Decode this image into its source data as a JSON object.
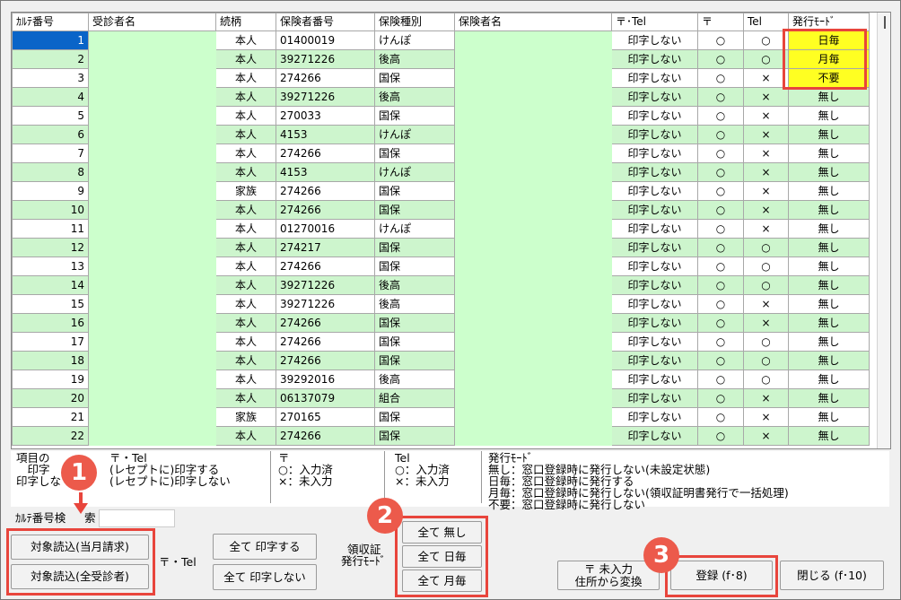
{
  "table": {
    "headers": [
      "ｶﾙﾃ番号",
      "受診者名",
      "続柄",
      "保険者番号",
      "保険種別",
      "保険者名",
      "〒･Tel",
      "〒",
      "Tel",
      "発行ﾓｰﾄﾞ"
    ],
    "rows": [
      [
        "1",
        "",
        "本人",
        "01400019",
        "けんぽ",
        "",
        "印字しない",
        "○",
        "○",
        "日毎"
      ],
      [
        "2",
        "",
        "本人",
        "39271226",
        "後高",
        "",
        "印字しない",
        "○",
        "○",
        "月毎"
      ],
      [
        "3",
        "",
        "本人",
        "274266",
        "国保",
        "",
        "印字しない",
        "○",
        "×",
        "不要"
      ],
      [
        "4",
        "",
        "本人",
        "39271226",
        "後高",
        "",
        "印字しない",
        "○",
        "×",
        "無し"
      ],
      [
        "5",
        "",
        "本人",
        "270033",
        "国保",
        "",
        "印字しない",
        "○",
        "×",
        "無し"
      ],
      [
        "6",
        "",
        "本人",
        "4153",
        "けんぽ",
        "",
        "印字しない",
        "○",
        "×",
        "無し"
      ],
      [
        "7",
        "",
        "本人",
        "274266",
        "国保",
        "",
        "印字しない",
        "○",
        "×",
        "無し"
      ],
      [
        "8",
        "",
        "本人",
        "4153",
        "けんぽ",
        "",
        "印字しない",
        "○",
        "×",
        "無し"
      ],
      [
        "9",
        "",
        "家族",
        "274266",
        "国保",
        "",
        "印字しない",
        "○",
        "×",
        "無し"
      ],
      [
        "10",
        "",
        "本人",
        "274266",
        "国保",
        "",
        "印字しない",
        "○",
        "×",
        "無し"
      ],
      [
        "11",
        "",
        "本人",
        "01270016",
        "けんぽ",
        "",
        "印字しない",
        "○",
        "×",
        "無し"
      ],
      [
        "12",
        "",
        "本人",
        "274217",
        "国保",
        "",
        "印字しない",
        "○",
        "○",
        "無し"
      ],
      [
        "13",
        "",
        "本人",
        "274266",
        "国保",
        "",
        "印字しない",
        "○",
        "○",
        "無し"
      ],
      [
        "14",
        "",
        "本人",
        "39271226",
        "後高",
        "",
        "印字しない",
        "○",
        "○",
        "無し"
      ],
      [
        "15",
        "",
        "本人",
        "39271226",
        "後高",
        "",
        "印字しない",
        "○",
        "×",
        "無し"
      ],
      [
        "16",
        "",
        "本人",
        "274266",
        "国保",
        "",
        "印字しない",
        "○",
        "×",
        "無し"
      ],
      [
        "17",
        "",
        "本人",
        "274266",
        "国保",
        "",
        "印字しない",
        "○",
        "○",
        "無し"
      ],
      [
        "18",
        "",
        "本人",
        "274266",
        "国保",
        "",
        "印字しない",
        "○",
        "○",
        "無し"
      ],
      [
        "19",
        "",
        "本人",
        "39292016",
        "後高",
        "",
        "印字しない",
        "○",
        "○",
        "無し"
      ],
      [
        "20",
        "",
        "本人",
        "06137079",
        "組合",
        "",
        "印字しない",
        "○",
        "×",
        "無し"
      ],
      [
        "21",
        "",
        "家族",
        "270165",
        "国保",
        "",
        "印字しない",
        "○",
        "×",
        "無し"
      ],
      [
        "22",
        "",
        "本人",
        "274266",
        "国保",
        "",
        "印字しない",
        "○",
        "×",
        "無し"
      ]
    ]
  },
  "legend": {
    "col1_l1": "項目の",
    "col1_head": "〒・Tel",
    "col1_l2": "　印字",
    "col1_l2b": "(レセプトに)印字する",
    "col1_l3": "印字しな",
    "col1_l3b": "(レセプトに)印字しない",
    "col2_head": "〒",
    "col2_l1": "○：入力済",
    "col2_l2": "×：未入力",
    "col3_head": "Tel",
    "col3_l1": "○：入力済",
    "col3_l2": "×：未入力",
    "col4_head": "発行ﾓｰﾄﾞ",
    "col4_l1": "無し：窓口登録時に発行しない(未設定状態)",
    "col4_l2": "日毎：窓口登録時に発行する",
    "col4_l3": "月毎：窓口登録時に発行しない(領収証明書発行で一括処理)",
    "col4_l4": "不要：窓口登録時に発行しない"
  },
  "controls": {
    "karte_label": "ｶﾙﾃ番号検",
    "karte_label2": "索",
    "btn_read_month": "対象読込(当月請求)",
    "btn_read_all": "対象読込(全受診者)",
    "label_tel": "〒・Tel",
    "btn_print_all": "全て 印字する",
    "btn_noprint_all": "全て 印字しない",
    "label_receipt1": "領収証",
    "label_receipt2": "発行ﾓｰﾄﾞ",
    "btn_all_none": "全て 無し",
    "btn_all_daily": "全て 日毎",
    "btn_all_monthly": "全て 月毎",
    "btn_convert_1": "〒 未入力",
    "btn_convert_2": "住所から変換",
    "btn_register": "登録 (f･8)",
    "btn_close": "閉じる (f･10)"
  },
  "badges": {
    "b1": "1",
    "b2": "2",
    "b3": "3"
  },
  "colors": {
    "row_green": "#cdf5cd",
    "selected": "#0a64c8",
    "highlight": "#ffff22",
    "annotation_red": "#e8453c"
  }
}
